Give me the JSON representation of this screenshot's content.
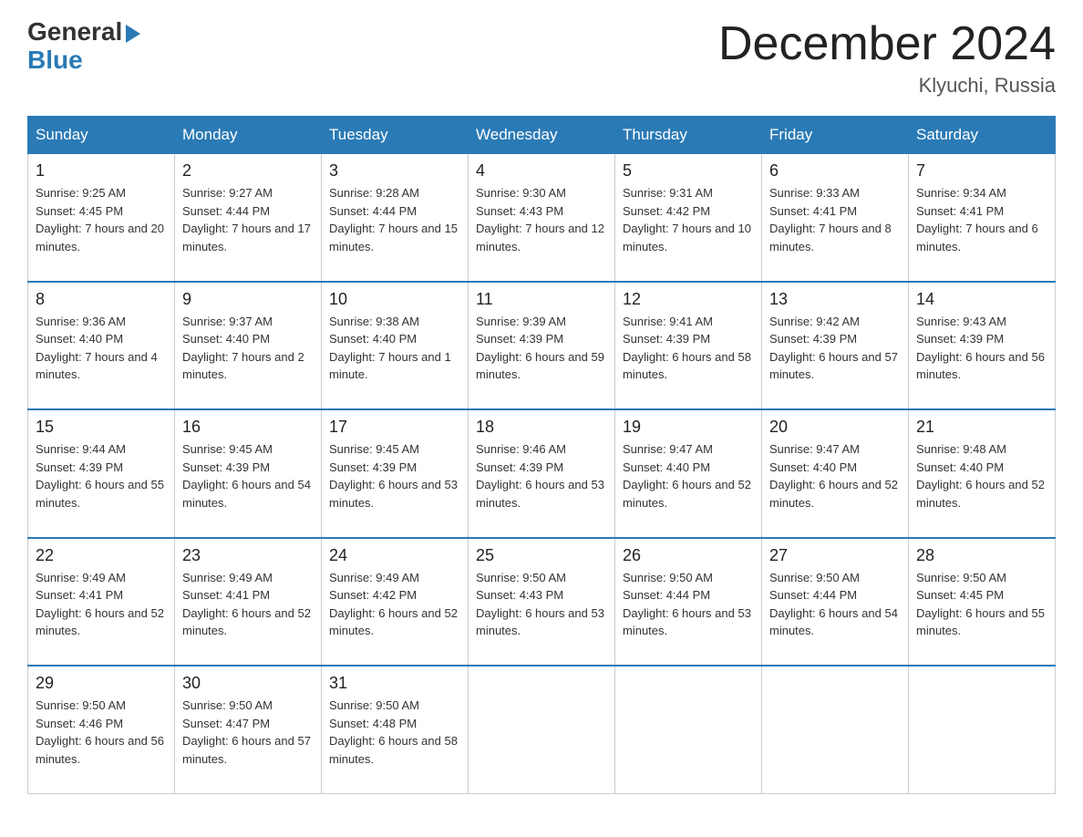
{
  "header": {
    "logo_general": "General",
    "logo_blue": "Blue",
    "month_title": "December 2024",
    "location": "Klyuchi, Russia"
  },
  "days_of_week": [
    "Sunday",
    "Monday",
    "Tuesday",
    "Wednesday",
    "Thursday",
    "Friday",
    "Saturday"
  ],
  "weeks": [
    [
      {
        "day": "1",
        "sunrise": "9:25 AM",
        "sunset": "4:45 PM",
        "daylight": "7 hours and 20 minutes."
      },
      {
        "day": "2",
        "sunrise": "9:27 AM",
        "sunset": "4:44 PM",
        "daylight": "7 hours and 17 minutes."
      },
      {
        "day": "3",
        "sunrise": "9:28 AM",
        "sunset": "4:44 PM",
        "daylight": "7 hours and 15 minutes."
      },
      {
        "day": "4",
        "sunrise": "9:30 AM",
        "sunset": "4:43 PM",
        "daylight": "7 hours and 12 minutes."
      },
      {
        "day": "5",
        "sunrise": "9:31 AM",
        "sunset": "4:42 PM",
        "daylight": "7 hours and 10 minutes."
      },
      {
        "day": "6",
        "sunrise": "9:33 AM",
        "sunset": "4:41 PM",
        "daylight": "7 hours and 8 minutes."
      },
      {
        "day": "7",
        "sunrise": "9:34 AM",
        "sunset": "4:41 PM",
        "daylight": "7 hours and 6 minutes."
      }
    ],
    [
      {
        "day": "8",
        "sunrise": "9:36 AM",
        "sunset": "4:40 PM",
        "daylight": "7 hours and 4 minutes."
      },
      {
        "day": "9",
        "sunrise": "9:37 AM",
        "sunset": "4:40 PM",
        "daylight": "7 hours and 2 minutes."
      },
      {
        "day": "10",
        "sunrise": "9:38 AM",
        "sunset": "4:40 PM",
        "daylight": "7 hours and 1 minute."
      },
      {
        "day": "11",
        "sunrise": "9:39 AM",
        "sunset": "4:39 PM",
        "daylight": "6 hours and 59 minutes."
      },
      {
        "day": "12",
        "sunrise": "9:41 AM",
        "sunset": "4:39 PM",
        "daylight": "6 hours and 58 minutes."
      },
      {
        "day": "13",
        "sunrise": "9:42 AM",
        "sunset": "4:39 PM",
        "daylight": "6 hours and 57 minutes."
      },
      {
        "day": "14",
        "sunrise": "9:43 AM",
        "sunset": "4:39 PM",
        "daylight": "6 hours and 56 minutes."
      }
    ],
    [
      {
        "day": "15",
        "sunrise": "9:44 AM",
        "sunset": "4:39 PM",
        "daylight": "6 hours and 55 minutes."
      },
      {
        "day": "16",
        "sunrise": "9:45 AM",
        "sunset": "4:39 PM",
        "daylight": "6 hours and 54 minutes."
      },
      {
        "day": "17",
        "sunrise": "9:45 AM",
        "sunset": "4:39 PM",
        "daylight": "6 hours and 53 minutes."
      },
      {
        "day": "18",
        "sunrise": "9:46 AM",
        "sunset": "4:39 PM",
        "daylight": "6 hours and 53 minutes."
      },
      {
        "day": "19",
        "sunrise": "9:47 AM",
        "sunset": "4:40 PM",
        "daylight": "6 hours and 52 minutes."
      },
      {
        "day": "20",
        "sunrise": "9:47 AM",
        "sunset": "4:40 PM",
        "daylight": "6 hours and 52 minutes."
      },
      {
        "day": "21",
        "sunrise": "9:48 AM",
        "sunset": "4:40 PM",
        "daylight": "6 hours and 52 minutes."
      }
    ],
    [
      {
        "day": "22",
        "sunrise": "9:49 AM",
        "sunset": "4:41 PM",
        "daylight": "6 hours and 52 minutes."
      },
      {
        "day": "23",
        "sunrise": "9:49 AM",
        "sunset": "4:41 PM",
        "daylight": "6 hours and 52 minutes."
      },
      {
        "day": "24",
        "sunrise": "9:49 AM",
        "sunset": "4:42 PM",
        "daylight": "6 hours and 52 minutes."
      },
      {
        "day": "25",
        "sunrise": "9:50 AM",
        "sunset": "4:43 PM",
        "daylight": "6 hours and 53 minutes."
      },
      {
        "day": "26",
        "sunrise": "9:50 AM",
        "sunset": "4:44 PM",
        "daylight": "6 hours and 53 minutes."
      },
      {
        "day": "27",
        "sunrise": "9:50 AM",
        "sunset": "4:44 PM",
        "daylight": "6 hours and 54 minutes."
      },
      {
        "day": "28",
        "sunrise": "9:50 AM",
        "sunset": "4:45 PM",
        "daylight": "6 hours and 55 minutes."
      }
    ],
    [
      {
        "day": "29",
        "sunrise": "9:50 AM",
        "sunset": "4:46 PM",
        "daylight": "6 hours and 56 minutes."
      },
      {
        "day": "30",
        "sunrise": "9:50 AM",
        "sunset": "4:47 PM",
        "daylight": "6 hours and 57 minutes."
      },
      {
        "day": "31",
        "sunrise": "9:50 AM",
        "sunset": "4:48 PM",
        "daylight": "6 hours and 58 minutes."
      },
      null,
      null,
      null,
      null
    ]
  ],
  "labels": {
    "sunrise": "Sunrise:",
    "sunset": "Sunset:",
    "daylight": "Daylight:"
  }
}
